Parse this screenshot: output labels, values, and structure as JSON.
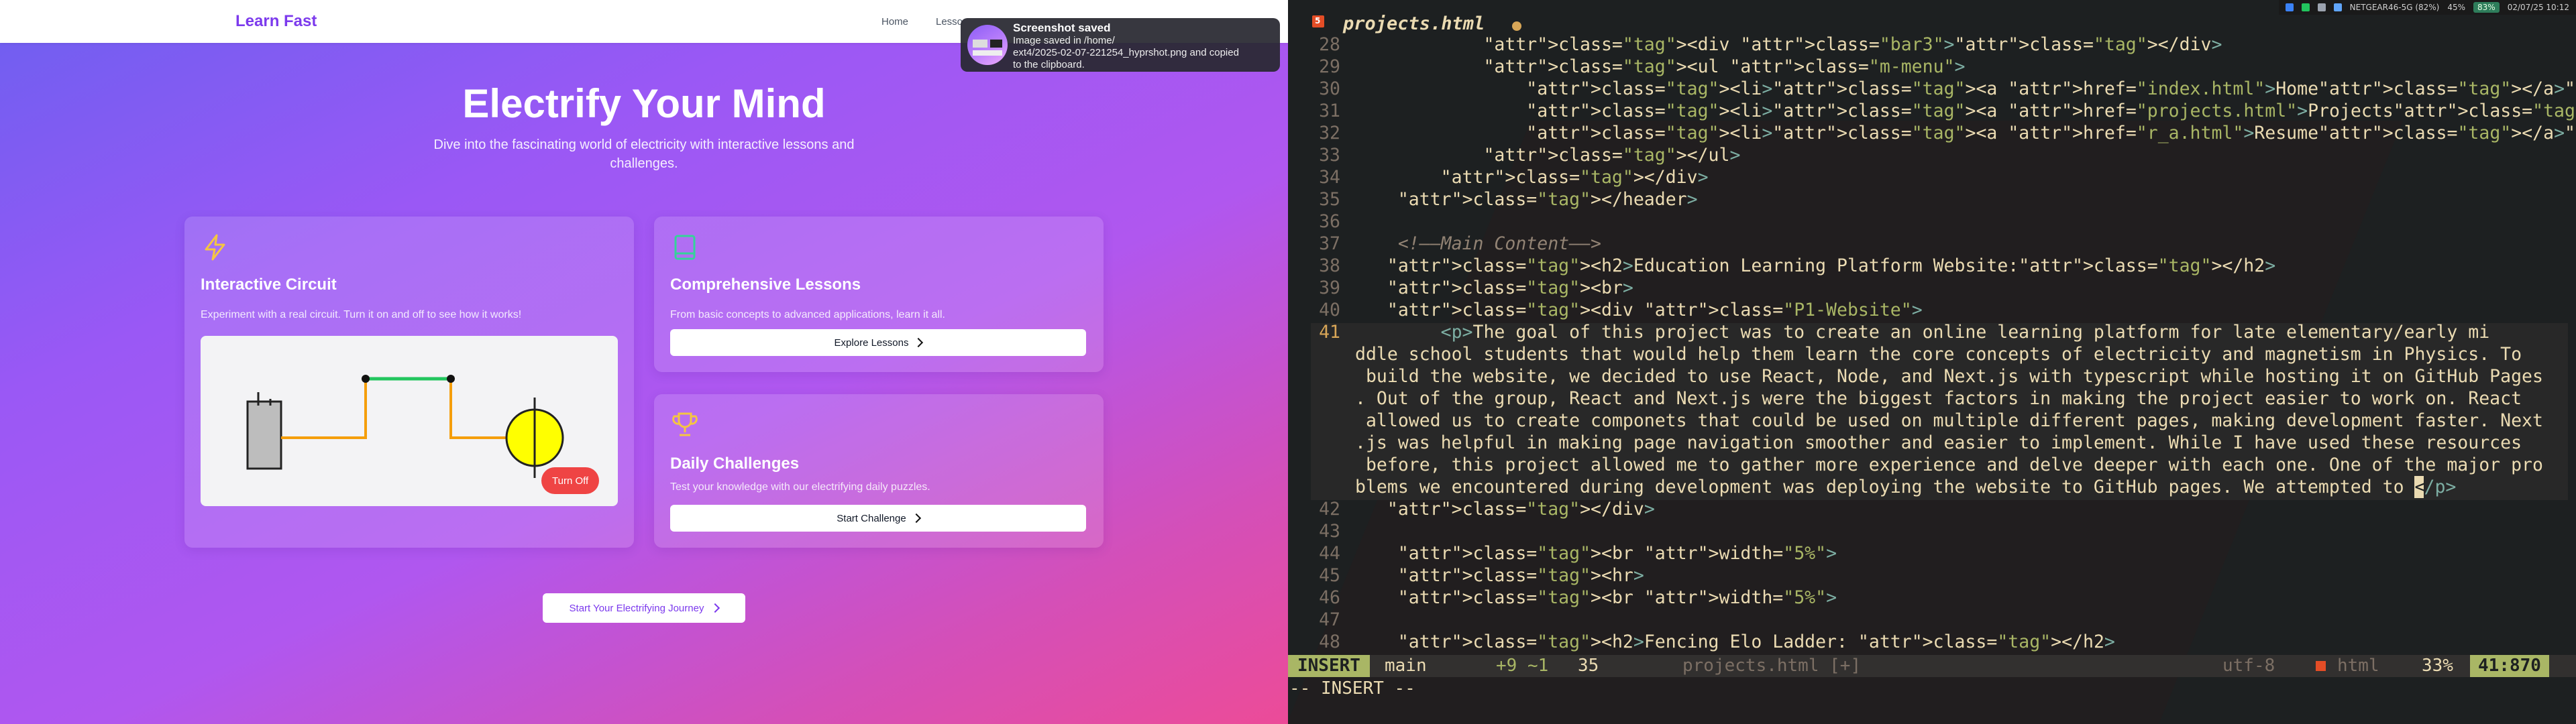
{
  "browser": {
    "nav": {
      "brand": "Learn Fast",
      "links": [
        "Home",
        "Lesso"
      ]
    },
    "hero": {
      "title": "Electrify Your Mind",
      "subtitle": "Dive into the fascinating world of electricity with interactive lessons and challenges."
    },
    "cards": {
      "circuit": {
        "title": "Interactive Circuit",
        "text": "Experiment with a real circuit. Turn it on and off to see how it works!",
        "toggle_label": "Turn Off"
      },
      "lessons": {
        "title": "Comprehensive Lessons",
        "text": "From basic concepts to advanced applications, learn it all.",
        "button": "Explore Lessons"
      },
      "challenges": {
        "title": "Daily Challenges",
        "text": "Test your knowledge with our electrifying daily puzzles.",
        "button": "Start Challenge"
      }
    },
    "cta": "Start Your Electrifying Journey",
    "colors": {
      "accent": "#7c3aed",
      "danger": "#ef4444",
      "icon": "#f5c542"
    }
  },
  "notification": {
    "title": "Screenshot saved",
    "line1": "Image saved in /home/",
    "line2": "ext4/2025-02-07-221254_hyprshot.png and copied",
    "line3": "to the clipboard."
  },
  "system_bar": {
    "wifi": "NETGEAR46-5G (82%)",
    "volume": "45%",
    "battery": "83%",
    "datetime": "02/07/25 10:12"
  },
  "editor": {
    "filename": "projects.html",
    "lines": [
      {
        "n": "28",
        "indent": "            ",
        "html": "&lt;div class=\"bar3\"&gt;&lt;/div&gt;"
      },
      {
        "n": "29",
        "indent": "            ",
        "html": "&lt;ul class=\"m-menu\"&gt;"
      },
      {
        "n": "30",
        "indent": "                ",
        "html": "&lt;li&gt;&lt;a href=\"index.html\"&gt;Home&lt;/a&gt;&lt;/li&gt;"
      },
      {
        "n": "31",
        "indent": "                ",
        "html": "&lt;li&gt;&lt;a href=\"projects.html\"&gt;Projects&lt;/a&gt;&lt;/li&gt;"
      },
      {
        "n": "32",
        "indent": "                ",
        "html": "&lt;li&gt;&lt;a href=\"r_a.html\"&gt;Resume&lt;/a&gt;&lt;/li&gt;"
      },
      {
        "n": "33",
        "indent": "            ",
        "html": "&lt;/ul&gt;"
      },
      {
        "n": "34",
        "indent": "        ",
        "html": "&lt;/div&gt;"
      },
      {
        "n": "35",
        "indent": "    ",
        "html": "&lt;/header&gt;"
      },
      {
        "n": "36",
        "indent": "",
        "html": ""
      },
      {
        "n": "37",
        "indent": "    ",
        "html": "&lt;!——Main Content——&gt;"
      },
      {
        "n": "38",
        "indent": "   ",
        "html": "&lt;h2&gt;Education Learning Platform Website:&lt;/h2&gt;"
      },
      {
        "n": "39",
        "indent": "   ",
        "html": "&lt;br&gt;"
      },
      {
        "n": "40",
        "indent": "   ",
        "html": "&lt;div class=\"P1-Website\"&gt;"
      }
    ],
    "wrapped_line": {
      "n": "41",
      "rows": [
        "        <p>The goal of this project was to create an online learning platform for late elementary/early mi",
        "ddle school students that would help them learn the core concepts of electricity and magnetism in Physics. To",
        " build the website, we decided to use React, Node, and Next.js with typescript while hosting it on GitHub Pages",
        ". Out of the group, React and Next.js were the biggest factors in making the project easier to work on. React",
        " allowed us to create componets that could be used on multiple different pages, making development faster. Next",
        ".js was helpful in making page navigation smoother and easier to implement. While I have used these resources",
        " before, this project allowed me to gather more experience and delve deeper with each one. One of the major pro",
        "blems we encountered during development was deploying the website to GitHub pages. We attempted to "
      ],
      "after_cursor": "/p>",
      "cursor_char": "<"
    },
    "tail_lines": [
      {
        "n": "42",
        "indent": "   ",
        "html": "&lt;/div&gt;"
      },
      {
        "n": "43",
        "indent": "",
        "html": ""
      },
      {
        "n": "44",
        "indent": "    ",
        "html": "&lt;br width=\"5%\"&gt;"
      },
      {
        "n": "45",
        "indent": "    ",
        "html": "&lt;hr&gt;"
      },
      {
        "n": "46",
        "indent": "    ",
        "html": "&lt;br width=\"5%\"&gt;"
      },
      {
        "n": "47",
        "indent": "",
        "html": ""
      },
      {
        "n": "48",
        "indent": "    ",
        "html": "&lt;h2&gt;Fencing Elo Ladder: &lt;/h2&gt;"
      }
    ],
    "status": {
      "mode": "INSERT",
      "branch": " main",
      "diff": "+9 ~1",
      "lsp": "35",
      "file": "projects.html [+]",
      "encoding": "utf-8",
      "filetype": "html",
      "percent": "33%",
      "position": "41:870"
    },
    "cmdline": "-- INSERT --"
  }
}
